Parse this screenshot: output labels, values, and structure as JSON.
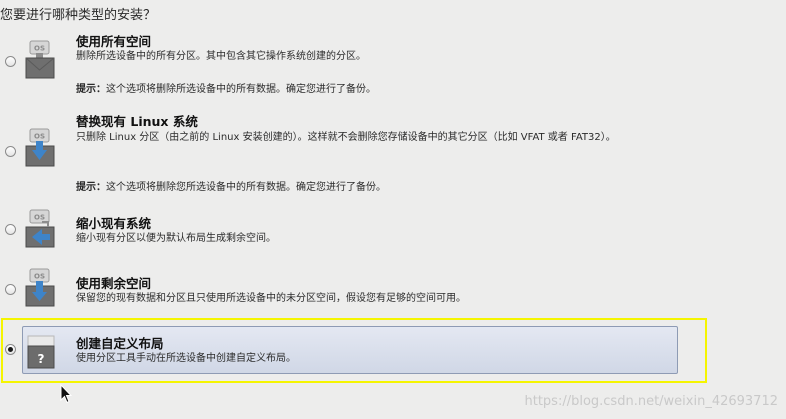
{
  "question": "您要进行哪种类型的安装？",
  "options": [
    {
      "title": "使用所有空间",
      "desc": "删除所选设备中的所有分区。其中包含其它操作系统创建的分区。",
      "hint_label": "提示：",
      "hint": "这个选项将删除所选设备中的所有数据。确定您进行了备份。",
      "icon_label": "OS",
      "checked": false
    },
    {
      "title": "替换现有 Linux 系统",
      "desc": "只删除 Linux 分区（由之前的 Linux 安装创建的）。这样就不会删除您存储设备中的其它分区（比如 VFAT 或者 FAT32）。",
      "hint_label": "提示：",
      "hint": "这个选项将删除您所选设备中的所有数据。确定您进行了备份。",
      "icon_label": "OS",
      "checked": false
    },
    {
      "title": "缩小现有系统",
      "desc": "缩小现有分区以便为默认布局生成剩余空间。",
      "icon_label": "OS",
      "checked": false
    },
    {
      "title": "使用剩余空间",
      "desc": "保留您的现有数据和分区且只使用所选设备中的未分区空间，假设您有足够的空间可用。",
      "icon_label": "OS",
      "checked": false
    },
    {
      "title": "创建自定义布局",
      "desc": "使用分区工具手动在所选设备中创建自定义布局。",
      "icon_label": "?",
      "checked": true
    }
  ],
  "watermark": "https://blog.csdn.net/weixin_42693712",
  "colors": {
    "background": "#ededec",
    "highlight_border": "#f5f500",
    "selected_panel": "#d6dcea"
  }
}
